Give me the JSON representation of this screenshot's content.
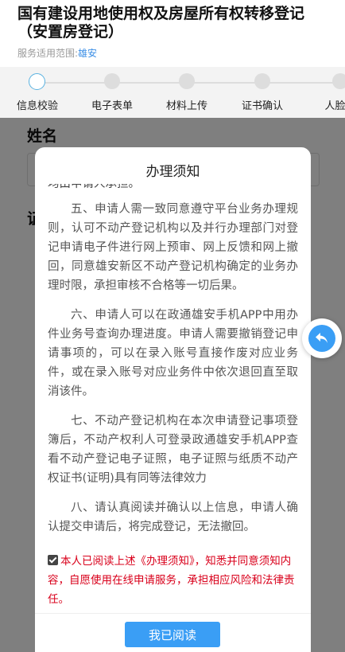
{
  "header": {
    "title": "国有建设用地使用权及房屋所有权转移登记（安置房登记）",
    "scope_label": "服务适用范围:",
    "scope_city": "雄安"
  },
  "steps": [
    {
      "label": "信息校验",
      "active": true
    },
    {
      "label": "电子表单",
      "active": false
    },
    {
      "label": "材料上传",
      "active": false
    },
    {
      "label": "证书确认",
      "active": false
    },
    {
      "label": "人脸认",
      "active": false
    }
  ],
  "form": {
    "name_label": "姓名",
    "name_placeholder": "请输",
    "id_label": "证"
  },
  "modal": {
    "title": "办理须知",
    "cut_text": "均由申请人承担。",
    "paragraphs": [
      "五、申请人需一致同意遵守平台业务办理规则，认可不动产登记机构以及并行办理部门对登记申请电子件进行网上预审、网上反馈和网上撤回，同意雄安新区不动产登记机构确定的业务办理时限，承担审核不合格等一切后果。",
      "六、申请人可以在政通雄安手机APP中用办件业务号查询办理进度。申请人需要撤销登记申请事项的，可以在录入账号直接作废对应业务件，或在录入账号对应业务件中依次退回直至取消该件。",
      "七、不动产登记机构在本次申请登记事项登簿后，不动产权利人可登录政通雄安手机APP查看不动产登记电子证照，电子证照与纸质不动产权证书(证明)具有同等法律效力",
      "八、请认真阅读并确认以上信息，申请人确认提交申请后，将完成登记，无法撤回。"
    ],
    "agree_text": "本人已阅读上述《办理须知》，知悉并同意须知内容，自愿使用在线申请服务，承担相应风险和法律责任。",
    "agree_checked": true,
    "button_label": "我已阅读"
  },
  "colors": {
    "accent": "#3a9ef5",
    "warning_text": "#d9001b"
  },
  "icons": {
    "float_button": "back-arrow-icon"
  }
}
